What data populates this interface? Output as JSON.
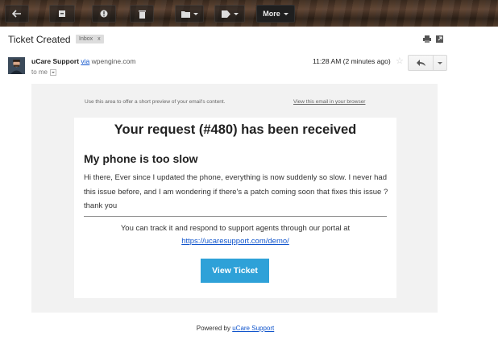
{
  "toolbar": {
    "more_label": "More"
  },
  "header": {
    "subject": "Ticket Created",
    "label_chip": "Inbox",
    "label_chip_close": "x"
  },
  "message": {
    "sender_name": "uCare Support",
    "via": "via",
    "via_domain": "wpengine.com",
    "to": "to me",
    "time": "11:28 AM (2 minutes ago)",
    "star": "☆"
  },
  "email": {
    "preview_text": "Use this area to offer a short preview of your email's content.",
    "browser_link": "View this email in your browser",
    "title": "Your request (#480) has been received",
    "issue_title": "My phone is too slow",
    "issue_body": "Hi there, Ever since I updated the phone, everything is now suddenly so slow. I never had this issue before, and I am wondering if there's a patch coming soon that fixes this issue ? thank you",
    "track_text": "You can track it and respond to support agents through our portal at",
    "portal_link": "https://ucaresupport.com/demo/",
    "button_label": "View Ticket",
    "powered_prefix": "Powered by",
    "powered_link": "uCare Support"
  },
  "colors": {
    "button": "#2ea1d8",
    "link": "#1155cc"
  }
}
